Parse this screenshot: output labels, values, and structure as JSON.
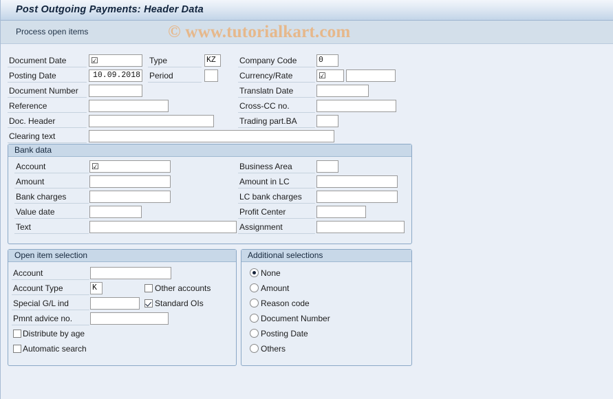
{
  "window": {
    "title": "Post Outgoing Payments: Header Data",
    "subtitle": "Process open items",
    "watermark": "© www.tutorialkart.com",
    "accent_color": "#c3d5e8",
    "panel_header_color": "#c8d8e8",
    "watermark_color": "#e8b584"
  },
  "header_form": {
    "left": [
      {
        "label": "Document Date",
        "value": "",
        "glyph": "☑"
      },
      {
        "label": "Posting Date",
        "value": "10.09.2018",
        "glyph": ""
      },
      {
        "label": "Document Number",
        "value": "",
        "glyph": ""
      },
      {
        "label": "Reference",
        "value": "",
        "glyph": ""
      },
      {
        "label": "Doc. Header",
        "value": "",
        "glyph": ""
      },
      {
        "label": "Clearing text",
        "value": "",
        "glyph": ""
      }
    ],
    "middle": [
      {
        "label": "Type",
        "value": "KZ"
      },
      {
        "label": "Period",
        "value": ""
      }
    ],
    "right": [
      {
        "label": "Company Code",
        "value": "0",
        "glyph": ""
      },
      {
        "label": "Currency/Rate",
        "value": "",
        "glyph": "☑"
      },
      {
        "label": "Translatn Date",
        "value": "",
        "glyph": ""
      },
      {
        "label": "Cross-CC no.",
        "value": "",
        "glyph": ""
      },
      {
        "label": "Trading part.BA",
        "value": "",
        "glyph": ""
      }
    ],
    "rate_value": ""
  },
  "bank_data": {
    "title": "Bank data",
    "left": [
      {
        "label": "Account",
        "value": "",
        "glyph": "☑"
      },
      {
        "label": "Amount",
        "value": "",
        "glyph": ""
      },
      {
        "label": "Bank charges",
        "value": "",
        "glyph": ""
      },
      {
        "label": "Value date",
        "value": "",
        "glyph": ""
      },
      {
        "label": "Text",
        "value": "",
        "glyph": ""
      }
    ],
    "right": [
      {
        "label": "Business Area",
        "value": ""
      },
      {
        "label": "Amount in LC",
        "value": ""
      },
      {
        "label": "LC bank charges",
        "value": ""
      },
      {
        "label": "Profit Center",
        "value": ""
      },
      {
        "label": "Assignment",
        "value": ""
      }
    ]
  },
  "open_item_selection": {
    "title": "Open item selection",
    "fields": [
      {
        "label": "Account",
        "value": ""
      },
      {
        "label": "Account Type",
        "value": "K"
      },
      {
        "label": "Special G/L ind",
        "value": ""
      },
      {
        "label": "Pmnt advice no.",
        "value": ""
      }
    ],
    "inline_checkboxes": [
      {
        "label": "Other accounts",
        "checked": false
      },
      {
        "label": "Standard OIs",
        "checked": true
      }
    ],
    "checkboxes": [
      {
        "label": "Distribute by age",
        "checked": false
      },
      {
        "label": "Automatic search",
        "checked": false
      }
    ]
  },
  "additional_selections": {
    "title": "Additional selections",
    "options": [
      {
        "label": "None",
        "selected": true
      },
      {
        "label": "Amount",
        "selected": false
      },
      {
        "label": "Reason code",
        "selected": false
      },
      {
        "label": "Document Number",
        "selected": false
      },
      {
        "label": "Posting Date",
        "selected": false
      },
      {
        "label": "Others",
        "selected": false
      }
    ]
  }
}
